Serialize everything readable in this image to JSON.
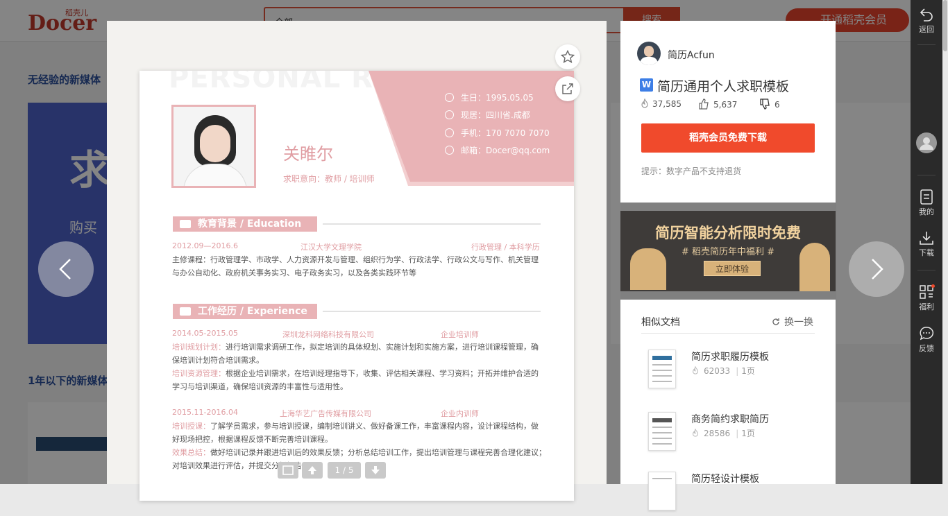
{
  "site": {
    "logo_text": "Docer",
    "logo_small": "稻壳儿",
    "search_select": "全部",
    "search_button": "搜索",
    "vip_button": "开通稻壳会员"
  },
  "background": {
    "section1_title": "无经验的新媒体",
    "section2_title": "1年以下的新媒体",
    "card1_big": "求",
    "card1_sub": "购买"
  },
  "viewer": {
    "pager": "1 / 5",
    "resume": {
      "watermark": "PERSONAL RESUME",
      "name": "关睢尔",
      "intent": "求职意向：教师 / 培训师",
      "contacts": [
        "生日：1995.05.05",
        "现居：四川省.成都",
        "手机：170 7070 7070",
        "邮箱：Docer@qq.com"
      ],
      "education": {
        "heading": "教育背景 / Education",
        "period": "2012.09—2016.6",
        "school": "江汉大学文理学院",
        "major": "行政管理 / 本科学历",
        "courses_line1": "主修课程：行政管理学、市政学、人力资源开发与管理、组织行为学、行政法学、行政公文与写作、机关管理",
        "courses_line2": "与办公自动化、政府机关事务实习、电子政务实习，以及各类实践环节等"
      },
      "experience": {
        "heading": "工作经历 / Experience",
        "job1": {
          "period": "2014.05-2015.05",
          "company": "深圳龙科网络科技有限公司",
          "title": "企业培训师",
          "k1": "培训规划计划：",
          "t1a": "进行培训需求调研工作，拟定培训的具体规划、实施计划和实施方案，进行培训课程管理，确",
          "t1b": "保培训计划符合培训需求。",
          "k2": "培训资源管理：",
          "t2a": "根据企业培训需求，在培训经理指导下，收集、评估相关课程、学习资料；开拓并维护合适的",
          "t2b": "学习与培训渠道，确保培训资源的丰富性与适用性。"
        },
        "job2": {
          "period": "2015.11-2016.04",
          "company": "上海华艺广告传媒有限公司",
          "title": "企业内训师",
          "k1": "培训授课：",
          "t1a": "了解学员需求，参与培训授课，编制培训讲义、做好备课工作，丰富课程内容，设计课程结构，做",
          "t1b": "好现场把控，根据课程反馈不断完善培训课程。",
          "k2": "效果总结：",
          "t2a": "做好培训记录并跟进培训后的效果反馈；分析总结培训工作，提出培训管理与课程完善合理化建议；",
          "t2b": "对培训效果进行评估，并提交分析报告。"
        }
      }
    }
  },
  "info": {
    "author": "简历Acfun",
    "doc_icon": "W",
    "title": "简历通用个人求职模板",
    "views": "37,585",
    "likes": "5,637",
    "dislikes": "6",
    "download_button": "稻壳会员免费下载",
    "tip": "提示：数字产品不支持退货"
  },
  "banner": {
    "title": "简历智能分析限时免费",
    "subtitle": "# 稻壳简历年中福利 #",
    "button": "立即体验"
  },
  "similar": {
    "title": "相似文档",
    "swap": "换一换",
    "items": [
      {
        "title": "简历求职履历模板",
        "views": "62033",
        "pages": "1页"
      },
      {
        "title": "商务简约求职简历",
        "views": "28586",
        "pages": "1页"
      },
      {
        "title": "简历轻设计模板",
        "views": "",
        "pages": ""
      }
    ]
  },
  "rail": {
    "back": "返回",
    "mine": "我的",
    "download": "下载",
    "welfare": "福利",
    "feedback": "反馈"
  }
}
